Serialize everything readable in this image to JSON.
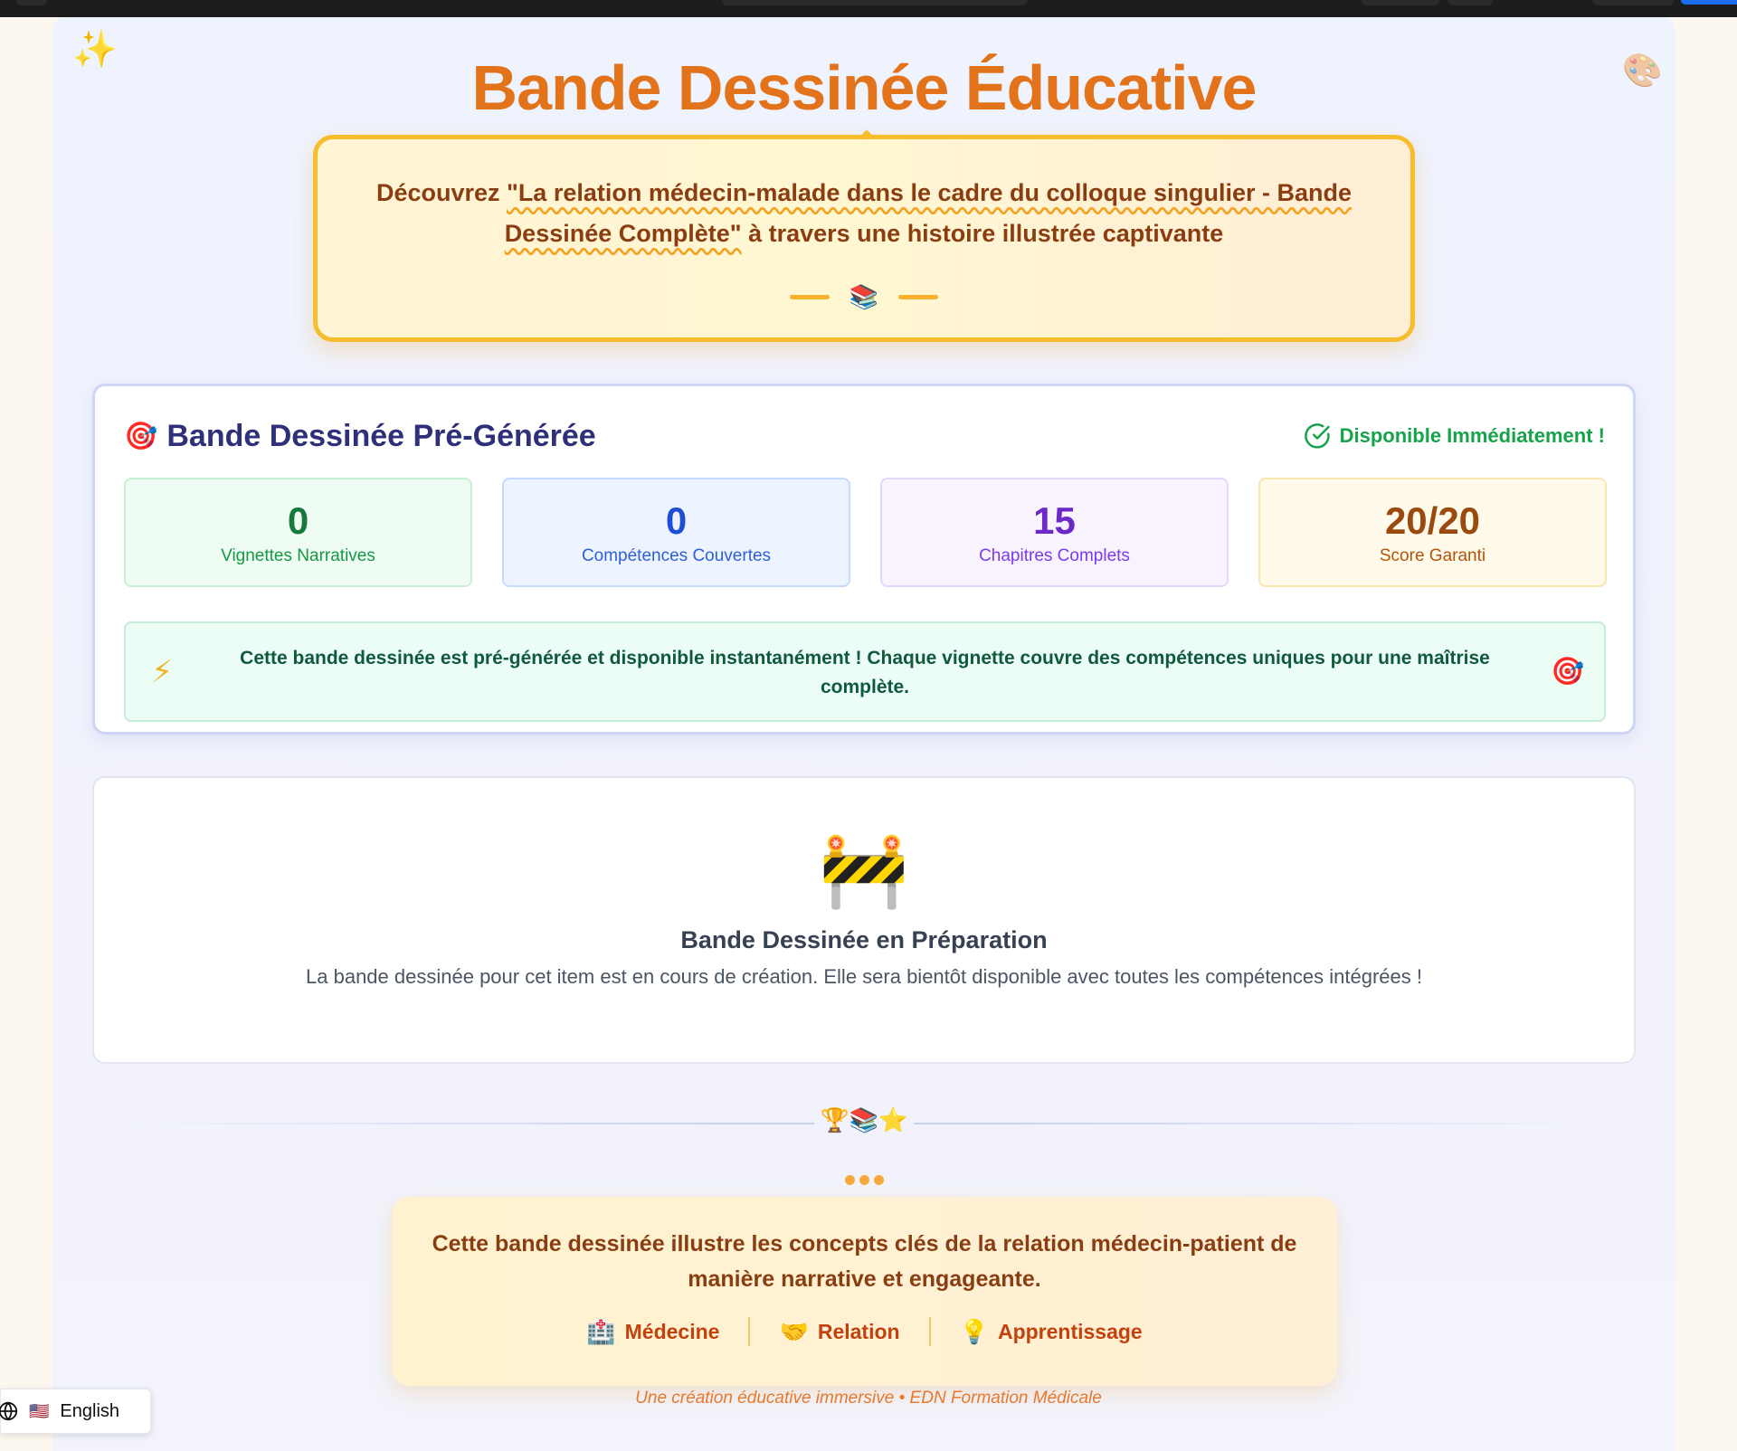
{
  "header": {
    "title": "Bande Dessinée Éducative",
    "intro_prefix": "Découvrez ",
    "intro_highlight": "\"La relation médecin-malade dans le cadre du colloque singulier - Bande Dessinée Complète\"",
    "intro_suffix": " à travers une histoire illustrée captivante",
    "divider_icon": "📚"
  },
  "decor": {
    "sparkle_icon": "✨",
    "palette_icon": "🎨"
  },
  "pregenerated": {
    "icon": "🎯",
    "title": "Bande Dessinée Pré-Générée",
    "availability": "Disponible Immédiatement !",
    "stats": [
      {
        "value": "0",
        "label": "Vignettes Narratives"
      },
      {
        "value": "0",
        "label": "Compétences Couvertes"
      },
      {
        "value": "15",
        "label": "Chapitres Complets"
      },
      {
        "value": "20/20",
        "label": "Score Garanti"
      }
    ],
    "notice_icon": "⚡",
    "notice": "Cette bande dessinée est pré-générée et disponible instantanément ! Chaque vignette couvre des compétences uniques pour une maîtrise complète.",
    "notice_end_icon": "🎯"
  },
  "preparation": {
    "icon": "🚧",
    "title": "Bande Dessinée en Préparation",
    "text": "La bande dessinée pour cet item est en cours de création. Elle sera bientôt disponible avec toutes les compétences intégrées !"
  },
  "separator_icons": "🏆📚⭐",
  "conclusion": {
    "text": "Cette bande dessinée illustre les concepts clés de la relation médecin-patient de manière narrative et engageante.",
    "tags": [
      {
        "icon": "🏥",
        "label": "Médecine"
      },
      {
        "icon": "🤝",
        "label": "Relation"
      },
      {
        "icon": "💡",
        "label": "Apprentissage"
      }
    ]
  },
  "footer": "Une création éducative immersive • EDN Formation Médicale",
  "language_switcher": {
    "flag": "🇺🇸",
    "label": "English"
  },
  "colors": {
    "accent_orange": "#e2731b",
    "title_navy": "#2e307a",
    "success_green": "#16a34a"
  }
}
